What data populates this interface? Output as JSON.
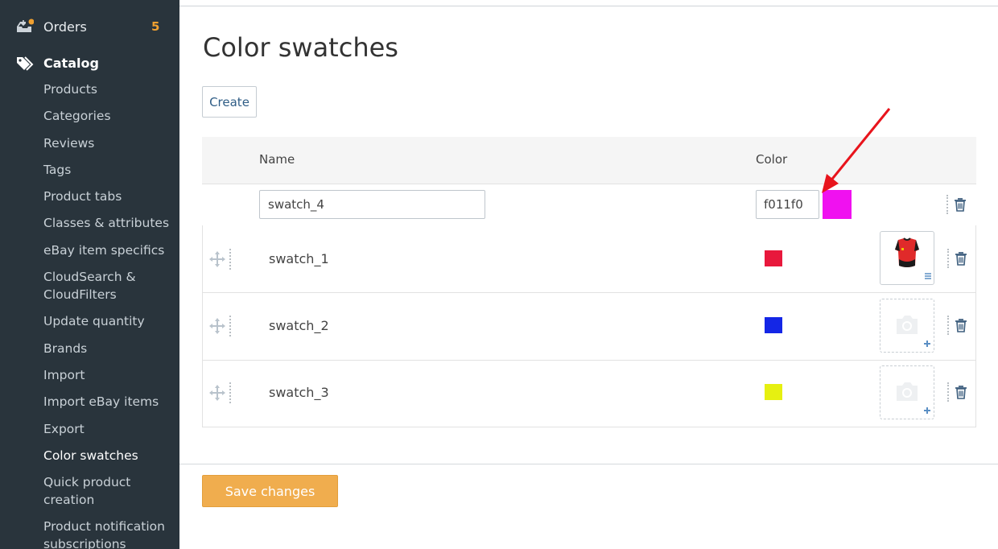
{
  "sidebar": {
    "orders": {
      "label": "Orders",
      "count": "5"
    },
    "catalog": {
      "label": "Catalog"
    },
    "items": [
      {
        "label": "Products"
      },
      {
        "label": "Categories"
      },
      {
        "label": "Reviews"
      },
      {
        "label": "Tags"
      },
      {
        "label": "Product tabs"
      },
      {
        "label": "Classes & attributes"
      },
      {
        "label": "eBay item specifics"
      },
      {
        "label": "CloudSearch & CloudFilters"
      },
      {
        "label": "Update quantity"
      },
      {
        "label": "Brands"
      },
      {
        "label": "Import"
      },
      {
        "label": "Import eBay items"
      },
      {
        "label": "Export"
      },
      {
        "label": "Color swatches"
      },
      {
        "label": "Quick product creation"
      },
      {
        "label": "Product notification subscriptions"
      }
    ]
  },
  "main": {
    "title": "Color swatches",
    "create_label": "Create",
    "headers": {
      "name": "Name",
      "color": "Color"
    },
    "new_row": {
      "name_value": "swatch_4",
      "color_value": "f011f0",
      "preview_color": "#f011f0"
    },
    "rows": [
      {
        "name": "swatch_1",
        "color": "#e8183c",
        "has_image": true
      },
      {
        "name": "swatch_2",
        "color": "#1426e6",
        "has_image": false
      },
      {
        "name": "swatch_3",
        "color": "#e6f011",
        "has_image": false
      }
    ],
    "save_label": "Save changes"
  },
  "colors": {
    "sidebar_bg": "#29343c",
    "accent_orange": "#f0ad4e",
    "annotation_red": "#e8141c"
  }
}
